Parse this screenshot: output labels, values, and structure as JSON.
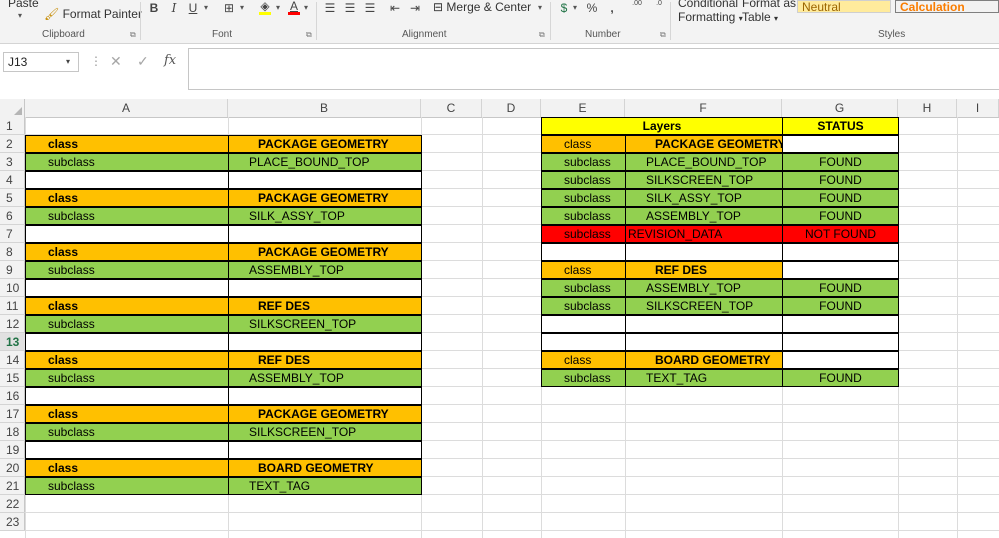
{
  "ribbon": {
    "clipboard": {
      "paste": "Paste",
      "format_painter": "Format Painter",
      "label": "Clipboard"
    },
    "font": {
      "bold": "B",
      "italic": "I",
      "underline": "U",
      "font_color_glyph": "A",
      "label": "Font"
    },
    "alignment": {
      "merge_center": "Merge & Center",
      "label": "Alignment"
    },
    "number": {
      "currency_glyph": "$",
      "percent": "%",
      "comma": ",",
      "inc_decimal": ".00",
      "dec_decimal": ".0",
      "label": "Number"
    },
    "styles": {
      "conditional_formatting_line1": "Conditional",
      "conditional_formatting_line2": "Formatting",
      "format_as_table_line1": "Format as",
      "format_as_table_line2": "Table",
      "neutral": "Neutral",
      "calculation": "Calculation",
      "label": "Styles",
      "neutral_color": "#ffeb9c",
      "calculation_color": "#f2f2f2"
    }
  },
  "formula_bar": {
    "name_box": "J13",
    "fx": "fx",
    "value": ""
  },
  "sheet": {
    "columns": [
      "A",
      "B",
      "C",
      "D",
      "E",
      "F",
      "G",
      "H",
      "I"
    ],
    "rows": [
      "1",
      "2",
      "3",
      "4",
      "5",
      "6",
      "7",
      "8",
      "9",
      "10",
      "11",
      "12",
      "13",
      "14",
      "15",
      "16",
      "17",
      "18",
      "19",
      "20",
      "21",
      "22",
      "23"
    ],
    "active_row": "13",
    "colors": {
      "orange": "#ffc000",
      "green": "#92d050",
      "red": "#ff0000",
      "yellow": "#ffff00"
    },
    "left_table": [
      {
        "a": "class",
        "b": "PACKAGE GEOMETRY"
      },
      {
        "a": "subclass",
        "b": "PLACE_BOUND_TOP"
      },
      {
        "a": "class",
        "b": "PACKAGE GEOMETRY"
      },
      {
        "a": "subclass",
        "b": "SILK_ASSY_TOP"
      },
      {
        "a": "class",
        "b": "PACKAGE GEOMETRY"
      },
      {
        "a": "subclass",
        "b": "ASSEMBLY_TOP"
      },
      {
        "a": "class",
        "b": "REF DES"
      },
      {
        "a": "subclass",
        "b": "SILKSCREEN_TOP"
      },
      {
        "a": "class",
        "b": "REF DES"
      },
      {
        "a": "subclass",
        "b": "ASSEMBLY_TOP"
      },
      {
        "a": "class",
        "b": "PACKAGE GEOMETRY"
      },
      {
        "a": "subclass",
        "b": "SILKSCREEN_TOP"
      },
      {
        "a": "class",
        "b": "BOARD GEOMETRY"
      },
      {
        "a": "subclass",
        "b": "TEXT_TAG"
      }
    ],
    "right_table": {
      "header_layers": "Layers",
      "header_status": "STATUS",
      "rows": [
        {
          "e": "class",
          "f": "PACKAGE GEOMETRY",
          "g": ""
        },
        {
          "e": "subclass",
          "f": "PLACE_BOUND_TOP",
          "g": "FOUND"
        },
        {
          "e": "subclass",
          "f": "SILKSCREEN_TOP",
          "g": "FOUND"
        },
        {
          "e": "subclass",
          "f": "SILK_ASSY_TOP",
          "g": "FOUND"
        },
        {
          "e": "subclass",
          "f": "ASSEMBLY_TOP",
          "g": "FOUND"
        },
        {
          "e": "subclass",
          "f": "REVISION_DATA",
          "g": "NOT FOUND"
        },
        {
          "e": "class",
          "f": "REF DES",
          "g": ""
        },
        {
          "e": "subclass",
          "f": "ASSEMBLY_TOP",
          "g": "FOUND"
        },
        {
          "e": "subclass",
          "f": "SILKSCREEN_TOP",
          "g": "FOUND"
        },
        {
          "e": "class",
          "f": "BOARD GEOMETRY",
          "g": ""
        },
        {
          "e": "subclass",
          "f": "TEXT_TAG",
          "g": "FOUND"
        }
      ]
    }
  }
}
